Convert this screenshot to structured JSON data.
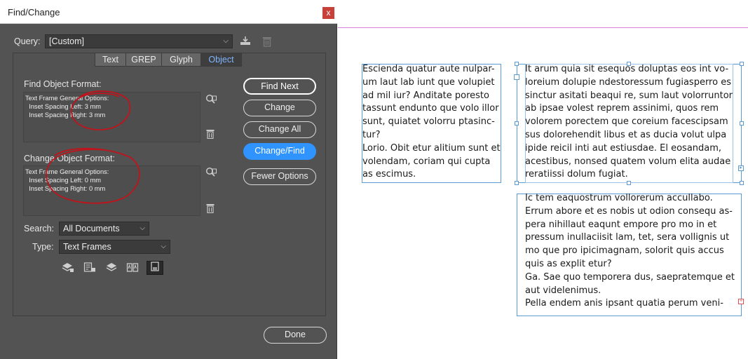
{
  "dialog": {
    "title": "Find/Change",
    "close_glyph": "x",
    "query_label": "Query:",
    "query_value": "[Custom]",
    "tabs": [
      {
        "label": "Text",
        "active": false
      },
      {
        "label": "GREP",
        "active": false
      },
      {
        "label": "Glyph",
        "active": false
      },
      {
        "label": "Object",
        "active": true
      }
    ],
    "find_format": {
      "label": "Find Object Format:",
      "lines": [
        "Text Frame General Options:",
        "  Inset Spacing Left: 3 mm",
        "  Inset Spacing Right: 3 mm"
      ]
    },
    "change_format": {
      "label": "Change Object Format:",
      "lines": [
        "Text Frame General Options:",
        "  Inset Spacing Left: 0 mm",
        "  Inset Spacing Right: 0 mm"
      ]
    },
    "buttons": {
      "find_next": "Find Next",
      "change": "Change",
      "change_all": "Change All",
      "change_find": "Change/Find",
      "fewer_options": "Fewer Options",
      "done": "Done"
    },
    "search_label": "Search:",
    "search_value": "All Documents",
    "type_label": "Type:",
    "type_value": "Text Frames",
    "scope_icons": [
      "include-locked-layers-icon",
      "include-locked-objects-icon",
      "include-hidden-layers-icon",
      "include-master-pages-icon",
      "include-footnotes-icon"
    ],
    "icons": [
      "save-query-icon",
      "delete-query-icon",
      "specify-find-format-icon",
      "clear-find-format-icon",
      "specify-change-format-icon",
      "clear-change-format-icon"
    ],
    "annotation_color": "#c0141c"
  },
  "document": {
    "frame1_lines": [
      "Escienda quatur aute nulpar-",
      "um laut lab iunt que volupiet",
      "ad mil iur? Anditate poresto",
      "tassunt endunto que volo illor",
      "sunt, quiatet volorru ptasinc-",
      "tur?",
      "Lorio. Obit etur alitium sunt et",
      "volendam, coriam qui cupta",
      "as escimus."
    ],
    "frame2_lines": [
      "It arum quia sit esequos doluptas eos int vo-",
      "loreium dolupie ndestoressum fugiasperro es",
      "sinctur asitati beaqui re, sum laut volorruntor",
      "ab ipsae volest reprem assinimi, quos rem",
      "volorem porectem que coreium facescipsam",
      "sus dolorehendit libus et as ducia volut ulpa",
      "ipide reicil inti aut estiusdae. El eosandam,",
      "acestibus, nonsed quatem volum elita audae",
      "reratiissi dolum fugiat."
    ],
    "frame3_lines": [
      "Ic tem eaquostrum vollorerum accullabo.",
      "Errum abore et es nobis ut odion consequ as-",
      "pera nihillaut eaqunt empore pro mo in et",
      "pressum inullaciisit lam, tet, sera vollignis ut",
      "mo que pro ipicimagnam, solorit quis accus",
      "quis as explit etur?",
      "Ga. Sae quo temporera dus, saepratemque et",
      "aut videlenimus.",
      "Pella endem anis ipsant quatia perum veni-"
    ],
    "frame_color": "#5b9bd5",
    "guide_color": "#d880d8"
  }
}
